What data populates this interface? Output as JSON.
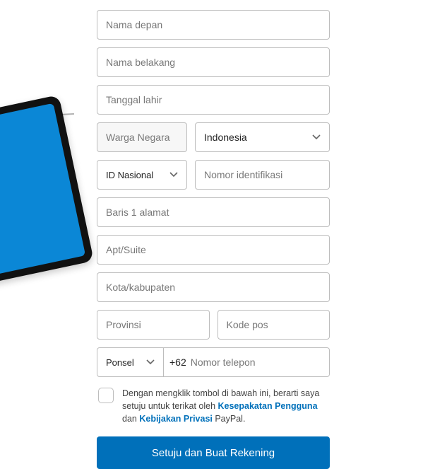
{
  "fields": {
    "first_name_ph": "Nama depan",
    "last_name_ph": "Nama belakang",
    "dob_ph": "Tanggal lahir",
    "citizen_label": "Warga Negara",
    "country_value": "Indonesia",
    "id_type_value": "ID Nasional",
    "id_number_ph": "Nomor identifikasi",
    "address1_ph": "Baris 1 alamat",
    "apt_ph": "Apt/Suite",
    "city_ph": "Kota/kabupaten",
    "province_ph": "Provinsi",
    "postal_ph": "Kode pos",
    "phone_type_value": "Ponsel",
    "country_code": "+62",
    "phone_ph": "Nomor telepon"
  },
  "agree": {
    "prefix": "Dengan mengklik tombol di bawah ini, berarti saya setuju untuk terikat oleh ",
    "link1": "Kesepakatan Pengguna",
    "mid": " dan ",
    "link2": "Kebijakan Privasi",
    "suffix": " PayPal."
  },
  "submit_label": "Setuju dan Buat Rekening"
}
